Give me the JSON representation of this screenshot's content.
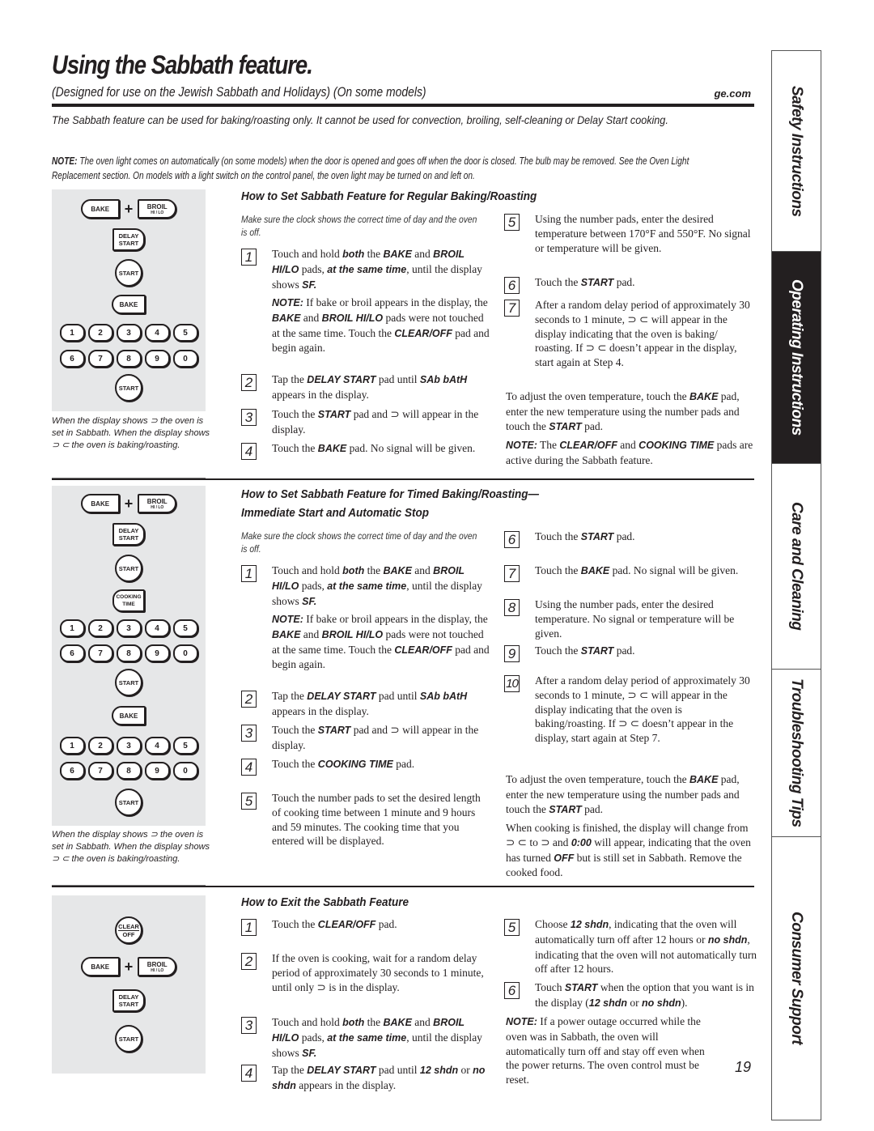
{
  "header": {
    "title": "Using the Sabbath feature.",
    "subtitle": "(Designed for use on the Jewish Sabbath and Holidays)  (On some models)",
    "site": "ge.com"
  },
  "intro": "The Sabbath feature can be used for baking/roasting only. It cannot be used for convection, broiling, self-cleaning or Delay Start cooking.",
  "top_note": {
    "label": "NOTE:",
    "text": " The oven light comes on automatically (on some models) when the door is opened and goes off when the door is closed. The bulb may be removed. See the Oven Light Replacement section. On models with a light switch on the control panel, the oven light may be turned on and left on."
  },
  "sidebar": {
    "tabs": [
      {
        "label": "Safety Instructions",
        "active": false
      },
      {
        "label": "Operating Instructions",
        "active": true
      },
      {
        "label": "Care and Cleaning",
        "active": false
      },
      {
        "label": "Troubleshooting Tips",
        "active": false
      },
      {
        "label": "Consumer Support",
        "active": false
      }
    ]
  },
  "keypad_labels": {
    "bake": "BAKE",
    "broil": "BROIL",
    "broil_sub": "HI / LO",
    "plus": "+",
    "delay1": "DELAY",
    "delay2": "START",
    "start": "START",
    "cooking1": "COOKING",
    "cooking2": "TIME",
    "clear1": "CLEAR",
    "clear2": "OFF",
    "nums_row1": [
      "1",
      "2",
      "3",
      "4",
      "5"
    ],
    "nums_row2": [
      "6",
      "7",
      "8",
      "9",
      "0"
    ]
  },
  "panel_caption": "When the display shows ⊃ the oven is set in Sabbath. When the display shows ⊃ ⊂  the oven is baking/roasting.",
  "section1": {
    "heading": "How to Set Sabbath Feature for Regular Baking/Roasting",
    "pre": "Make sure the clock shows the correct time of day and the oven is off.",
    "steps": [
      {
        "n": "1",
        "html": "Touch and hold <b>both</b> the <b>BAKE</b> and <b>BROIL HI/LO</b> pads, <b>at the same time</b>, until the display shows <b>SF.</b>"
      },
      {
        "n": "",
        "html": "<b>NOTE:</b> If bake or broil appears in the display, the <b>BAKE</b> and <b>BROIL HI/LO</b> pads were not touched at the same time. Touch the <b>CLEAR/OFF</b> pad and begin again."
      },
      {
        "n": "2",
        "html": "Tap the <b>DELAY START</b> pad until <b>SAb bAtH</b> appears in the display."
      },
      {
        "n": "3",
        "html": "Touch the <b>START</b> pad and ⊃ will appear in the display."
      },
      {
        "n": "4",
        "html": "Touch the <b>BAKE</b> pad. No signal will be given."
      },
      {
        "n": "5",
        "html": "Using the number pads, enter the desired temperature between 170°F and 550°F. No signal or temperature will be given."
      },
      {
        "n": "6",
        "html": "Touch the <b>START</b> pad."
      },
      {
        "n": "7",
        "html": "After a random delay period of approximately 30 seconds to 1 minute, ⊃ ⊂ will appear in the display indicating that the oven is baking/ roasting. If ⊃ ⊂ doesn’t appear in the display, start again at Step 4."
      }
    ],
    "adjust": "To adjust the oven temperature, touch the <b>BAKE</b> pad, enter the new temperature using the number pads and touch the <b>START</b> pad.",
    "note": "<b>NOTE:</b> The <b>CLEAR/OFF</b> and <b>COOKING TIME</b> pads are active during the Sabbath feature."
  },
  "section2": {
    "heading1": "How to Set Sabbath Feature for Timed Baking/Roasting—",
    "heading2": "Immediate Start and Automatic Stop",
    "pre": "Make sure the clock shows the correct time of day and the oven is off.",
    "steps": [
      {
        "n": "1",
        "html": "Touch and hold <b>both</b> the <b>BAKE</b> and <b>BROIL HI/LO</b> pads, <b>at the same time</b>, until the display shows <b>SF.</b>"
      },
      {
        "n": "",
        "html": "<b>NOTE:</b> If bake or broil appears in the display, the <b>BAKE</b> and <b>BROIL HI/LO</b> pads were not touched at the same time. Touch the <b>CLEAR/OFF</b> pad and begin again."
      },
      {
        "n": "2",
        "html": "Tap the <b>DELAY START</b> pad until <b>SAb bAtH</b> appears in the display."
      },
      {
        "n": "3",
        "html": "Touch the <b>START</b> pad and ⊃ will appear in the display."
      },
      {
        "n": "4",
        "html": "Touch the <b>COOKING TIME</b> pad."
      },
      {
        "n": "5",
        "html": "Touch the number pads to set the desired length of cooking time between 1 minute and 9 hours and 59 minutes. The cooking time that you entered will be displayed."
      },
      {
        "n": "6",
        "html": "Touch the <b>START</b> pad."
      },
      {
        "n": "7",
        "html": "Touch the <b>BAKE</b> pad. No signal will be given."
      },
      {
        "n": "8",
        "html": "Using the number pads, enter the desired temperature. No signal or temperature will be given."
      },
      {
        "n": "9",
        "html": "Touch the <b>START</b> pad."
      },
      {
        "n": "10",
        "html": "After a random delay period of approximately 30 seconds to 1 minute, ⊃ ⊂ will appear in the display indicating that the oven is baking/roasting. If ⊃ ⊂ doesn’t appear in the display, start again at Step 7."
      }
    ],
    "adjust": "To adjust the oven temperature, touch the <b>BAKE</b> pad, enter the new temperature using the number pads and touch the <b>START</b> pad.",
    "finished": "When cooking is finished, the display will change from ⊃ ⊂ to ⊃ and <b>0:00</b> will appear, indicating that the oven has turned <b>OFF</b> but is still set in Sabbath. Remove the cooked food."
  },
  "section3": {
    "heading": "How to Exit the Sabbath Feature",
    "steps": [
      {
        "n": "1",
        "html": "Touch the <b>CLEAR/OFF</b> pad."
      },
      {
        "n": "2",
        "html": "If the oven is cooking, wait for a random delay period of approximately 30 seconds to 1 minute, until only ⊃ is in the display."
      },
      {
        "n": "3",
        "html": "Touch and hold <b>both</b> the <b>BAKE</b> and <b>BROIL HI/LO</b> pads, <b>at the same time</b>, until the display shows <b>SF.</b>"
      },
      {
        "n": "4",
        "html": "Tap the <b>DELAY START</b> pad until <b>12 shdn</b> or <b>no shdn</b> appears in the display."
      },
      {
        "n": "5",
        "html": "Choose <b>12 shdn</b>, indicating that the oven will automatically turn off after 12 hours or <b>no shdn</b>, indicating that the oven will not automatically turn off after 12 hours."
      },
      {
        "n": "6",
        "html": "Touch <b>START</b> when the option that you want is in the display (<b>12 shdn</b> or <b>no shdn</b>)."
      }
    ],
    "note": "<b>NOTE:</b> If a power outage occurred while the oven was in Sabbath, the oven will automatically turn off and stay off even when the power returns. The oven control must be reset."
  },
  "page_number": "19"
}
